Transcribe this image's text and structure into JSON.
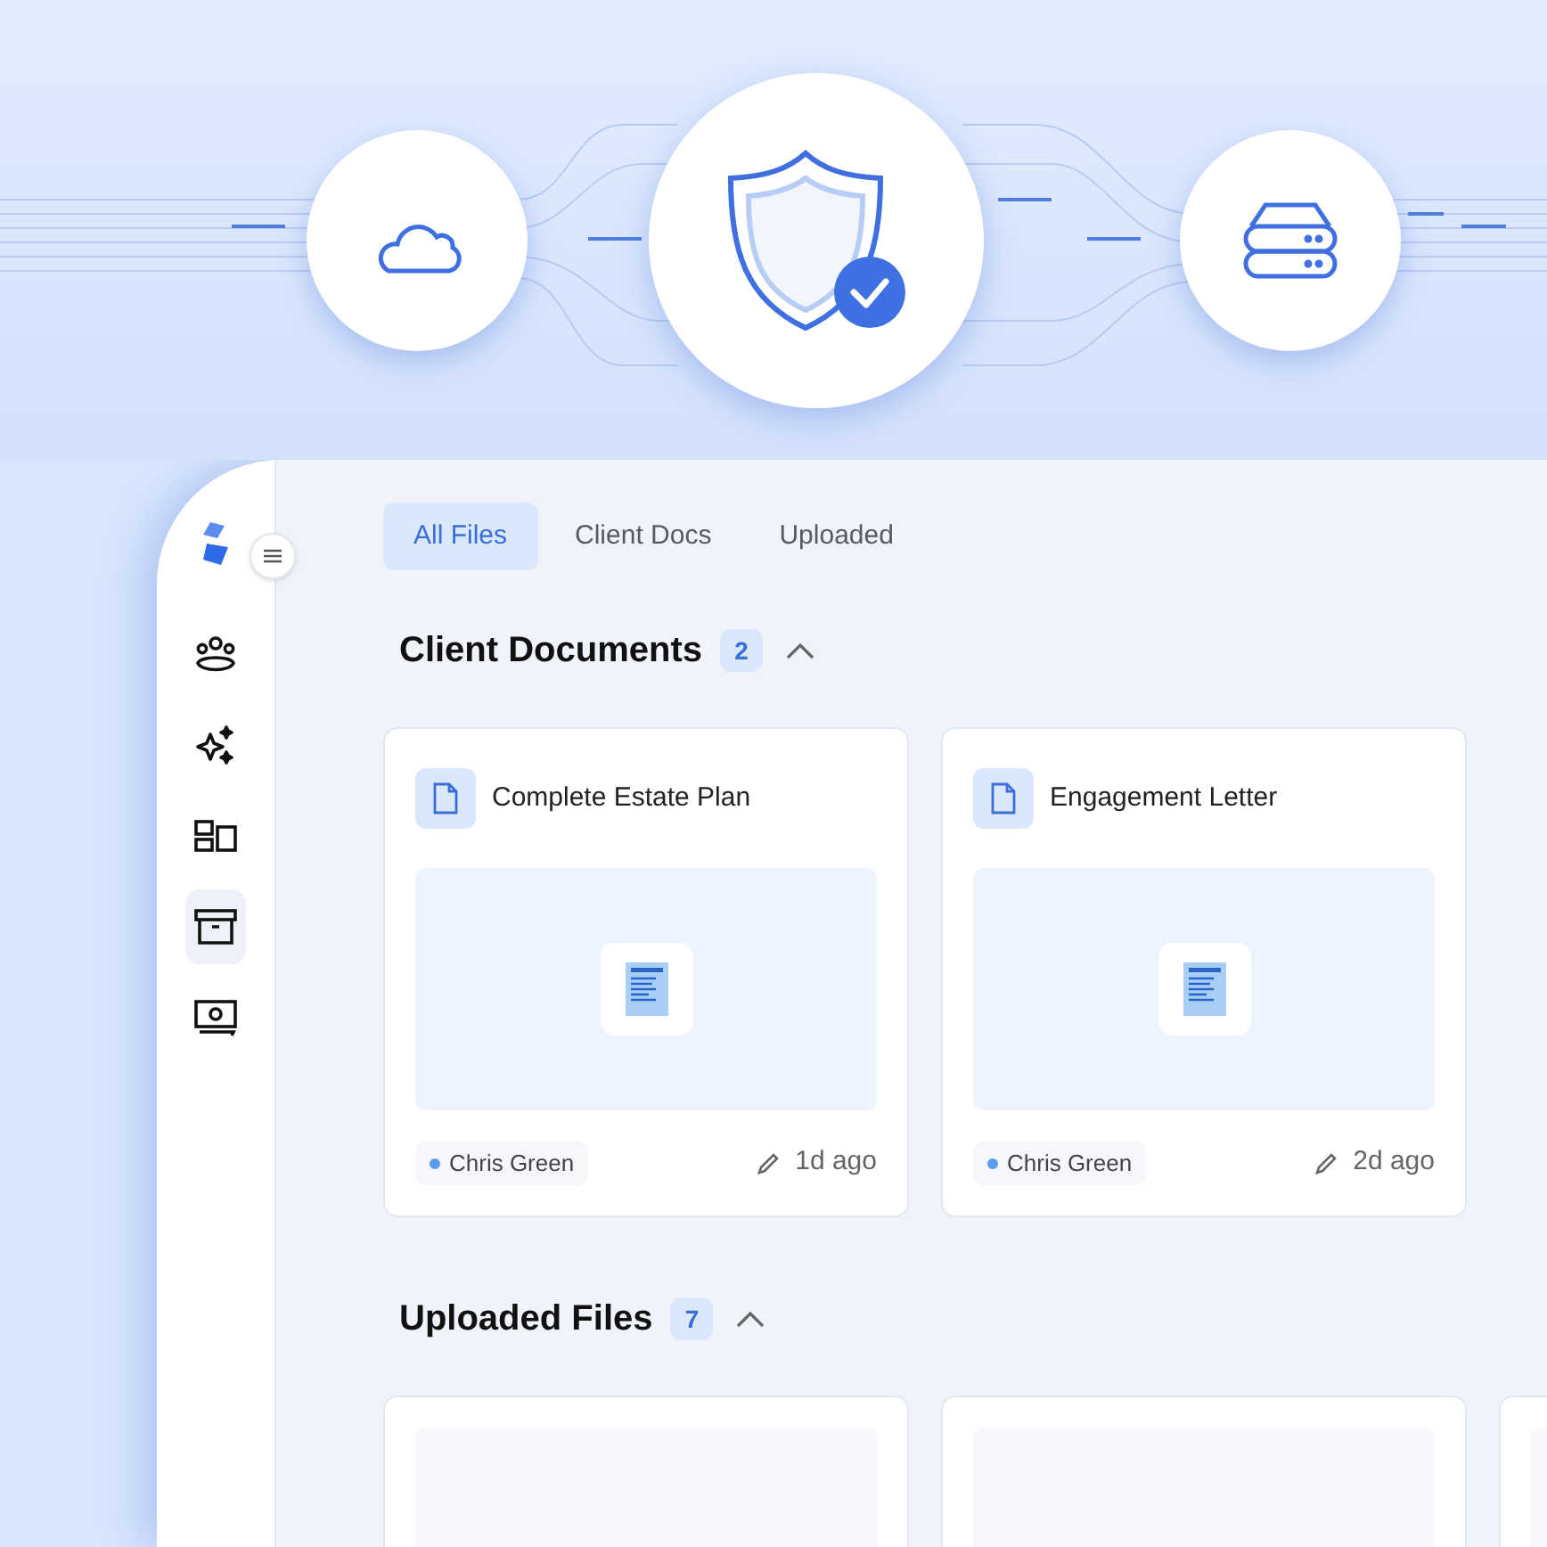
{
  "sidebar": {
    "items": [
      {
        "kind": "people",
        "selected": false
      },
      {
        "kind": "sparkles",
        "selected": false
      },
      {
        "kind": "layout",
        "selected": false
      },
      {
        "kind": "archive",
        "selected": true
      },
      {
        "kind": "money",
        "selected": false
      }
    ]
  },
  "tabs": [
    {
      "label": "All Files",
      "selected": true
    },
    {
      "label": "Client Docs",
      "selected": false
    },
    {
      "label": "Uploaded",
      "selected": false
    }
  ],
  "sections": [
    {
      "title": "Client Documents",
      "count": "2",
      "expanded": true,
      "cards": [
        {
          "kind": "document",
          "title": "Complete Estate Plan",
          "author": "Chris Green",
          "time": "1d ago"
        },
        {
          "kind": "document",
          "title": "Engagement Letter",
          "author": "Chris Green",
          "time": "2d ago"
        }
      ]
    },
    {
      "title": "Uploaded Files",
      "count": "7",
      "expanded": true,
      "cards": [
        {
          "kind": "placeholder"
        },
        {
          "kind": "placeholder"
        },
        {
          "kind": "placeholder"
        }
      ]
    }
  ]
}
